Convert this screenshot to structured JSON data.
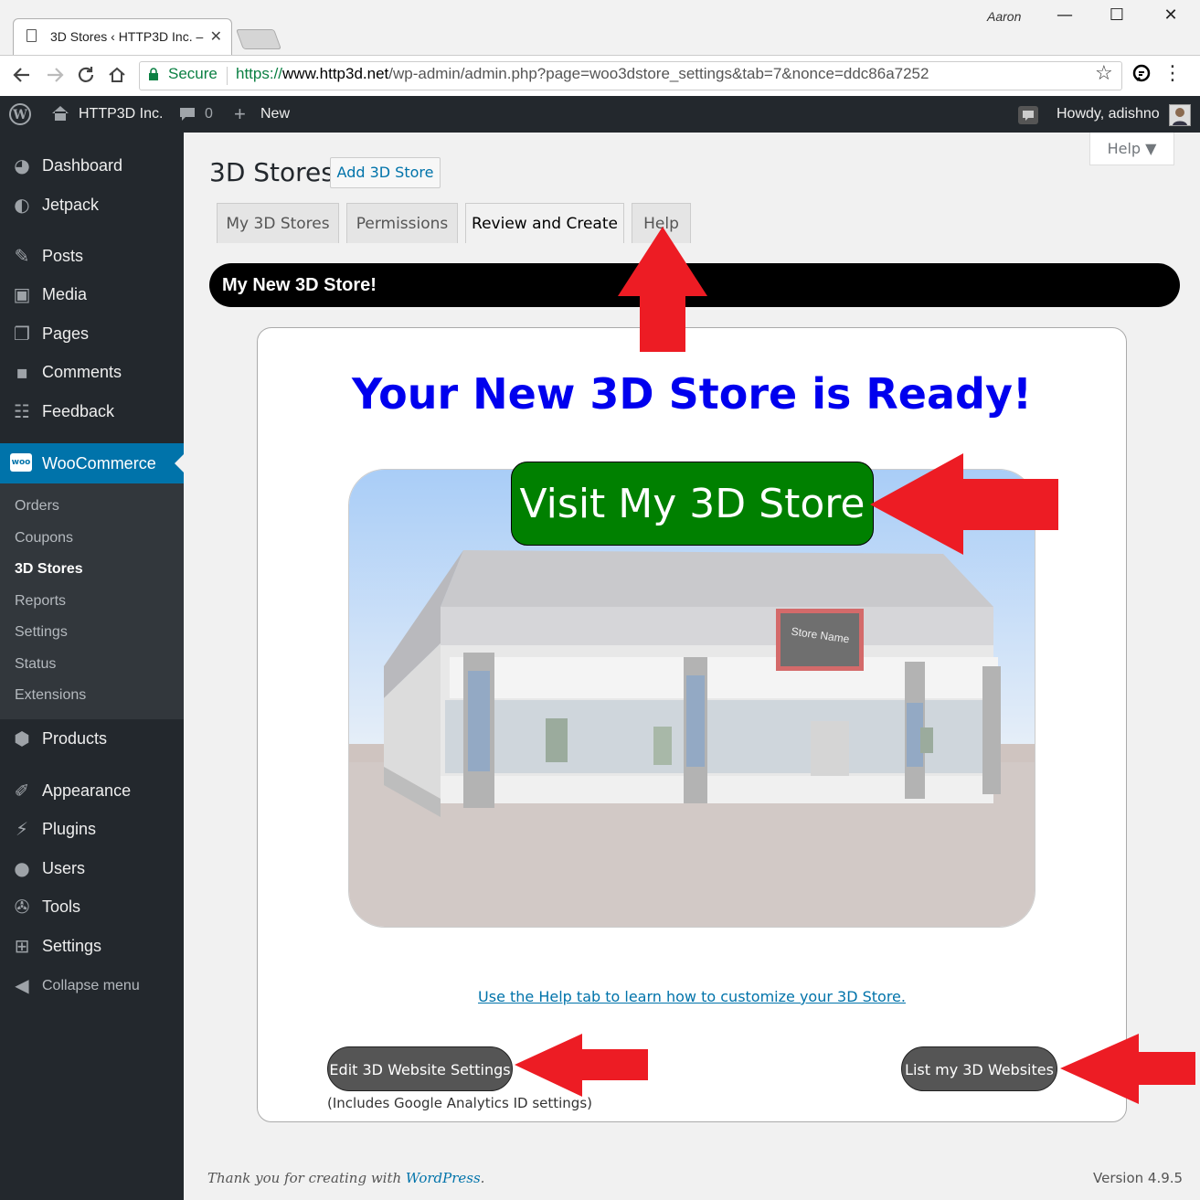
{
  "browser": {
    "tab_title": "3D Stores ‹ HTTP3D Inc. –",
    "tab_close": "✕",
    "profile_name": "Aaron",
    "window_controls": {
      "minimize": "—",
      "maximize": "☐",
      "close": "✕"
    },
    "nav_icons": {
      "back": "arrow-left-icon",
      "forward": "arrow-right-icon",
      "reload": "reload-icon",
      "home": "home-icon"
    },
    "secure_label": "Secure",
    "url": {
      "protocol": "https://",
      "host": "www.http3d.net",
      "path": "/wp-admin/admin.php?page=woo3dstore_settings&tab=7&nonce=ddc86a7252"
    },
    "star_icon": "☆",
    "menu_icon": "⋮"
  },
  "admin_bar": {
    "site_name": "HTTP3D Inc.",
    "comments_count": "0",
    "new_label": "New",
    "howdy": "Howdy, adishno"
  },
  "sidebar": {
    "top_items": [
      {
        "label": "Dashboard",
        "icon": "dashboard-icon"
      },
      {
        "label": "Jetpack",
        "icon": "jetpack-icon"
      },
      {
        "label": "Posts",
        "icon": "pin-icon"
      },
      {
        "label": "Media",
        "icon": "media-icon"
      },
      {
        "label": "Pages",
        "icon": "pages-icon"
      },
      {
        "label": "Comments",
        "icon": "comment-icon"
      },
      {
        "label": "Feedback",
        "icon": "feedback-icon"
      }
    ],
    "woocommerce": {
      "label": "WooCommerce",
      "icon_text": "woo"
    },
    "submenu": [
      "Orders",
      "Coupons",
      "3D Stores",
      "Reports",
      "Settings",
      "Status",
      "Extensions"
    ],
    "bottom_items": [
      {
        "label": "Products",
        "icon": "box-icon"
      },
      {
        "label": "Appearance",
        "icon": "brush-icon"
      },
      {
        "label": "Plugins",
        "icon": "plug-icon"
      },
      {
        "label": "Users",
        "icon": "user-icon"
      },
      {
        "label": "Tools",
        "icon": "wrench-icon"
      },
      {
        "label": "Settings",
        "icon": "settings-icon"
      },
      {
        "label": "Collapse menu",
        "icon": "collapse-icon"
      }
    ]
  },
  "main": {
    "page_title": "3D Stores",
    "add_button": "Add 3D Store",
    "help_button": "Help ▼",
    "tabs": [
      {
        "label": "My 3D Stores",
        "active": false
      },
      {
        "label": "Permissions",
        "active": false
      },
      {
        "label": "Review and Create",
        "active": true
      },
      {
        "label": "Help",
        "active": false
      }
    ],
    "banner": "My New 3D Store!",
    "ready_heading": "Your New 3D Store is Ready!",
    "visit_button": "Visit My 3D Store",
    "store_sign": "Store Name",
    "help_link": "Use the Help tab to learn how to customize your 3D Store.",
    "edit_button": "Edit 3D Website Settings",
    "edit_note": "(Includes Google Analytics ID settings)",
    "list_button": "List my 3D Websites"
  },
  "footer": {
    "thanks_prefix": "Thank you for creating with ",
    "wordpress_link": "WordPress",
    "thanks_suffix": ".",
    "version": "Version 4.9.5"
  },
  "colors": {
    "admin_dark": "#23282d",
    "woo_blue": "#0073aa",
    "ready_blue": "#0000ee",
    "visit_green": "#008000",
    "arrow_red": "#ed1c24",
    "gray_button": "#555555"
  }
}
